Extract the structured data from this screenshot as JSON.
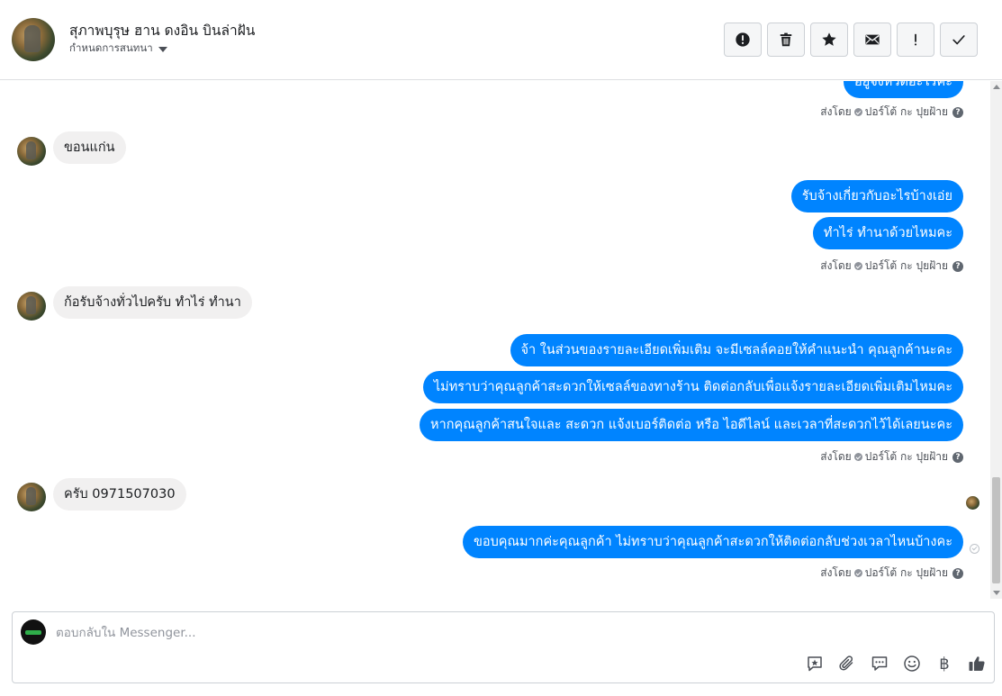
{
  "header": {
    "name": "สุภาพบุรุษ ฮาน ดงอิน บินล่าฝัน",
    "assign_label": "กำหนดการสนทนา",
    "toolbar": [
      {
        "icon": "alert-circle-icon"
      },
      {
        "icon": "trash-icon"
      },
      {
        "icon": "star-icon"
      },
      {
        "icon": "envelope-icon"
      },
      {
        "icon": "exclamation-icon",
        "label": "!"
      },
      {
        "icon": "check-icon"
      }
    ]
  },
  "messages": {
    "out_1_partial": "อยู่จังหวัดอะไรคะ",
    "sent_by_1": "ส่งโดย",
    "sender_name_1": "ปอร์โต้ กะ ปุยฝ้าย",
    "in_1": "ขอนแก่น",
    "out_2": "รับจ้างเกี่ยวกับอะไรบ้างเอ่ย",
    "out_3": "ทำไร่ ทำนาด้วยไหมคะ",
    "sent_by_2": "ส่งโดย",
    "sender_name_2": "ปอร์โต้ กะ ปุยฝ้าย",
    "in_2": "ก้อรับจ้างทั่วไปครับ ทำไร่ ทำนา",
    "out_4": "จ้า ในส่วนของรายละเอียดเพิ่มเติม จะมีเซลล์คอยให้คำแนะนำ คุณลูกค้านะคะ",
    "out_5": "ไม่ทราบว่าคุณลูกค้าสะดวกให้เซลล์ของทางร้าน ติดต่อกลับเพื่อแจ้งรายละเอียดเพิ่มเติมไหมคะ",
    "out_6": "หากคุณลูกค้าสนใจและ สะดวก แจ้งเบอร์ติดต่อ หรือ ไอดีไลน์ และเวลาที่สะดวกไว้ได้เลยนะคะ",
    "sent_by_3": "ส่งโดย",
    "sender_name_3": "ปอร์โต้ กะ ปุยฝ้าย",
    "in_3": "ครับ 0971507030",
    "out_7": "ขอบคุณมากค่ะคุณลูกค้า ไม่ทราบว่าคุณลูกค้าสะดวกให้ติดต่อกลับช่วงเวลาไหนบ้างคะ",
    "sent_by_4": "ส่งโดย",
    "sender_name_4": "ปอร์โต้ กะ ปุยฝ้าย"
  },
  "composer": {
    "placeholder": "ตอบกลับใน Messenger...",
    "icons": [
      "saved-reply-icon",
      "attachment-icon",
      "chat-bubbles-icon",
      "emoji-icon",
      "payment-icon",
      "like-icon"
    ],
    "baht_symbol": "฿"
  },
  "colors": {
    "outgoing_bubble": "#0084ff",
    "incoming_bubble": "#f1f0f0",
    "like_icon": "#4b4f56"
  }
}
